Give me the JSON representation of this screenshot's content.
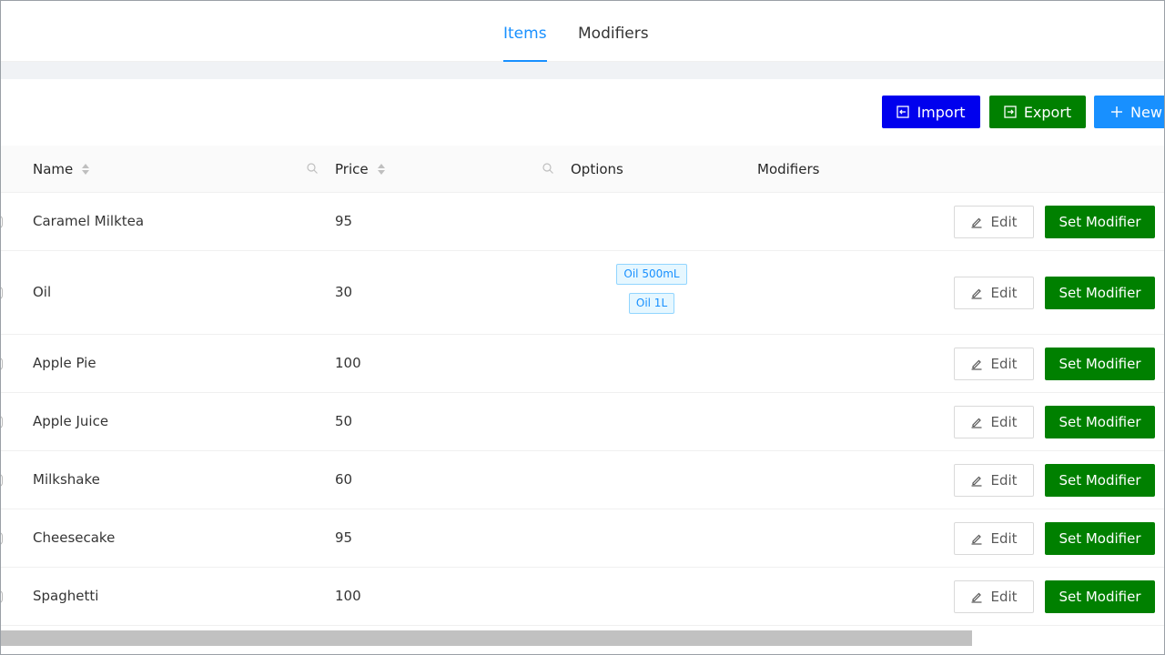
{
  "tabs": [
    {
      "label": "Items",
      "active": true
    },
    {
      "label": "Modifiers",
      "active": false
    }
  ],
  "toolbar": {
    "import_label": "Import",
    "export_label": "Export",
    "new_label": "New",
    "colors": {
      "import": "#0000ee",
      "export": "#008000",
      "new": "#1890ff"
    }
  },
  "table": {
    "columns": {
      "name": "Name",
      "price": "Price",
      "options": "Options",
      "modifiers": "Modifiers"
    },
    "rows": [
      {
        "name": "Caramel Milktea",
        "price": "95",
        "options": []
      },
      {
        "name": "Oil",
        "price": "30",
        "options": [
          "Oil 500mL",
          "Oil 1L"
        ]
      },
      {
        "name": "Apple Pie",
        "price": "100",
        "options": []
      },
      {
        "name": "Apple Juice",
        "price": "50",
        "options": []
      },
      {
        "name": "Milkshake",
        "price": "60",
        "options": []
      },
      {
        "name": "Cheesecake",
        "price": "95",
        "options": []
      },
      {
        "name": "Spaghetti",
        "price": "100",
        "options": []
      }
    ],
    "edit_label": "Edit",
    "set_modifier_label": "Set Modifier"
  }
}
